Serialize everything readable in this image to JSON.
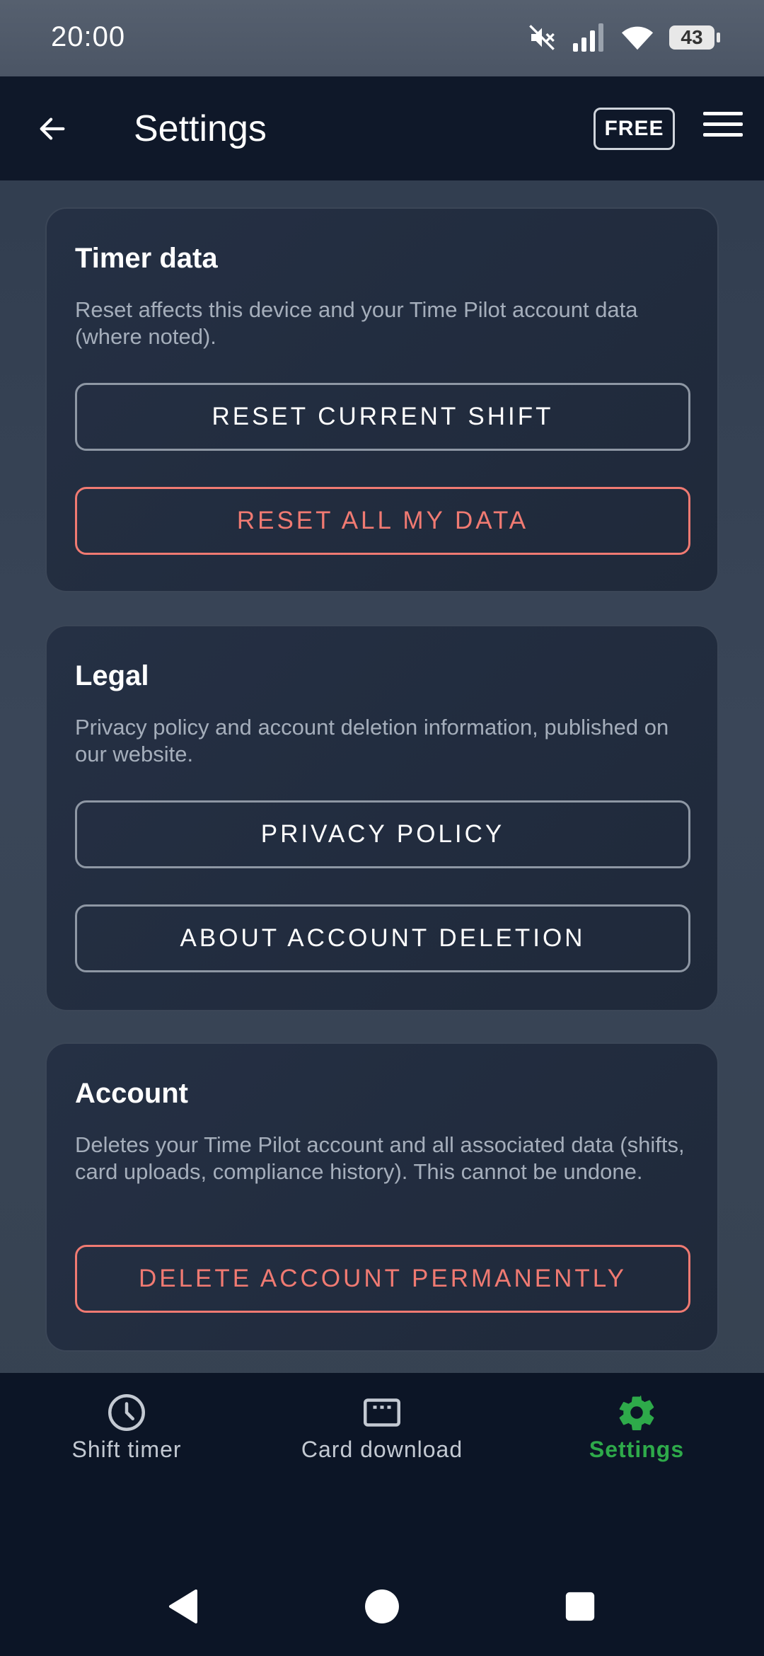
{
  "status_bar": {
    "time": "20:00",
    "battery": "43",
    "icons": [
      "mute-icon",
      "signal-icon",
      "wifi-icon",
      "battery-icon"
    ]
  },
  "app_bar": {
    "title": "Settings",
    "badge": "FREE",
    "back_icon": "arrow-left-icon",
    "menu_icon": "hamburger-menu-icon"
  },
  "sections": {
    "timer_data": {
      "title": "Timer data",
      "description": "Reset affects this device and your Time Pilot account data (where noted).",
      "buttons": {
        "reset_shift": "RESET CURRENT SHIFT",
        "reset_all": "RESET ALL MY DATA"
      }
    },
    "legal": {
      "title": "Legal",
      "description": "Privacy policy and account deletion information, published on our website.",
      "buttons": {
        "privacy": "PRIVACY POLICY",
        "account_deletion": "ABOUT ACCOUNT DELETION"
      }
    },
    "account": {
      "title": "Account",
      "description": "Deletes your Time Pilot account and all associated data (shifts, card uploads, compliance history). This cannot be undone.",
      "buttons": {
        "delete": "DELETE ACCOUNT PERMANENTLY"
      }
    }
  },
  "bottom_nav": {
    "items": [
      {
        "label": "Shift timer",
        "icon": "clock-icon",
        "active": false
      },
      {
        "label": "Card download",
        "icon": "card-reader-icon",
        "active": false
      },
      {
        "label": "Settings",
        "icon": "gear-icon",
        "active": true
      }
    ]
  },
  "colors": {
    "danger": "#f07a72",
    "active_nav": "#2eaa4a",
    "app_bar": "#0f1829",
    "card_bg": "#222c3e"
  }
}
